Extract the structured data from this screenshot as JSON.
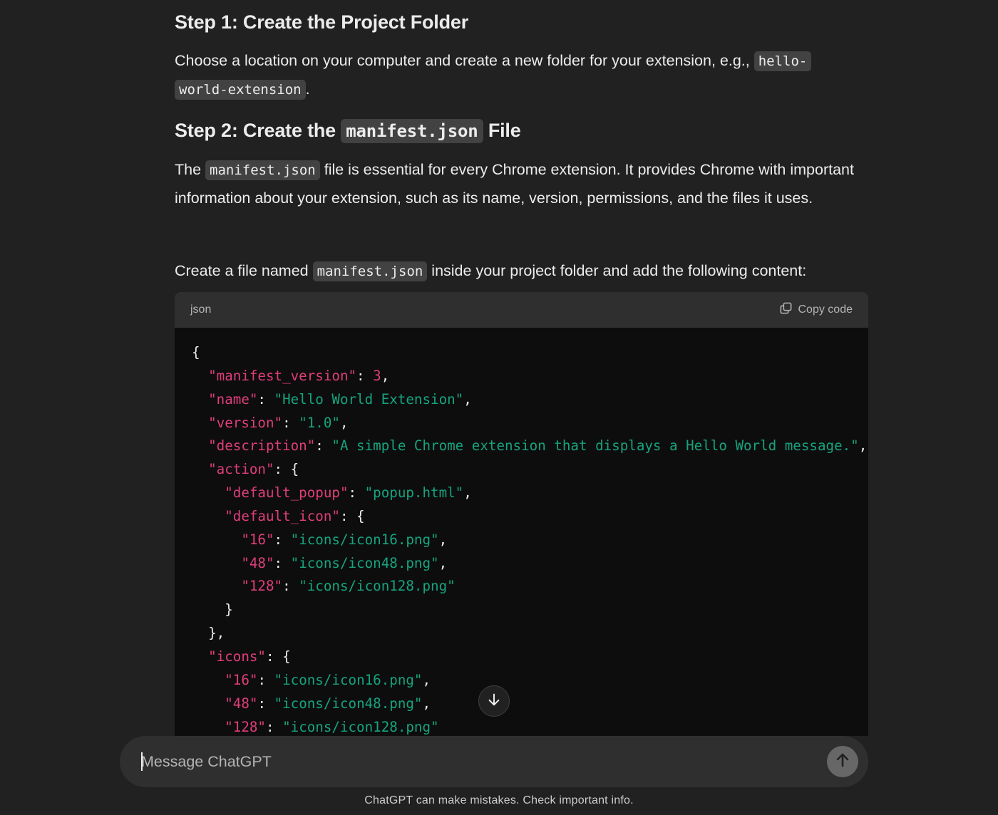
{
  "step1": {
    "heading": "Step 1: Create the Project Folder",
    "text_before": "Choose a location on your computer and create a new folder for your extension, e.g., ",
    "code_part1": "hello-",
    "code_part2": "world-extension",
    "text_after": "."
  },
  "step2": {
    "heading_before": "Step 2: Create the ",
    "heading_code": "manifest.json",
    "heading_after": " File",
    "p1_before": "The ",
    "p1_code": "manifest.json",
    "p1_after": " file is essential for every Chrome extension. It provides Chrome with important information about your extension, such as its name, version, permissions, and the files it uses.",
    "p2_before": "Create a file named ",
    "p2_code": "manifest.json",
    "p2_after": " inside your project folder and add the following content:"
  },
  "code_block": {
    "language": "json",
    "copy_label": "Copy code",
    "lines": [
      [
        {
          "t": "p",
          "v": "{"
        }
      ],
      [
        {
          "t": "p",
          "v": "  "
        },
        {
          "t": "k",
          "v": "\"manifest_version\""
        },
        {
          "t": "p",
          "v": ": "
        },
        {
          "t": "n",
          "v": "3"
        },
        {
          "t": "p",
          "v": ","
        }
      ],
      [
        {
          "t": "p",
          "v": "  "
        },
        {
          "t": "k",
          "v": "\"name\""
        },
        {
          "t": "p",
          "v": ": "
        },
        {
          "t": "s",
          "v": "\"Hello World Extension\""
        },
        {
          "t": "p",
          "v": ","
        }
      ],
      [
        {
          "t": "p",
          "v": "  "
        },
        {
          "t": "k",
          "v": "\"version\""
        },
        {
          "t": "p",
          "v": ": "
        },
        {
          "t": "s",
          "v": "\"1.0\""
        },
        {
          "t": "p",
          "v": ","
        }
      ],
      [
        {
          "t": "p",
          "v": "  "
        },
        {
          "t": "k",
          "v": "\"description\""
        },
        {
          "t": "p",
          "v": ": "
        },
        {
          "t": "s",
          "v": "\"A simple Chrome extension that displays a Hello World message.\""
        },
        {
          "t": "p",
          "v": ","
        }
      ],
      [
        {
          "t": "p",
          "v": "  "
        },
        {
          "t": "k",
          "v": "\"action\""
        },
        {
          "t": "p",
          "v": ": {"
        }
      ],
      [
        {
          "t": "p",
          "v": "    "
        },
        {
          "t": "k",
          "v": "\"default_popup\""
        },
        {
          "t": "p",
          "v": ": "
        },
        {
          "t": "s",
          "v": "\"popup.html\""
        },
        {
          "t": "p",
          "v": ","
        }
      ],
      [
        {
          "t": "p",
          "v": "    "
        },
        {
          "t": "k",
          "v": "\"default_icon\""
        },
        {
          "t": "p",
          "v": ": {"
        }
      ],
      [
        {
          "t": "p",
          "v": "      "
        },
        {
          "t": "k",
          "v": "\"16\""
        },
        {
          "t": "p",
          "v": ": "
        },
        {
          "t": "s",
          "v": "\"icons/icon16.png\""
        },
        {
          "t": "p",
          "v": ","
        }
      ],
      [
        {
          "t": "p",
          "v": "      "
        },
        {
          "t": "k",
          "v": "\"48\""
        },
        {
          "t": "p",
          "v": ": "
        },
        {
          "t": "s",
          "v": "\"icons/icon48.png\""
        },
        {
          "t": "p",
          "v": ","
        }
      ],
      [
        {
          "t": "p",
          "v": "      "
        },
        {
          "t": "k",
          "v": "\"128\""
        },
        {
          "t": "p",
          "v": ": "
        },
        {
          "t": "s",
          "v": "\"icons/icon128.png\""
        }
      ],
      [
        {
          "t": "p",
          "v": "    }"
        }
      ],
      [
        {
          "t": "p",
          "v": "  },"
        }
      ],
      [
        {
          "t": "p",
          "v": "  "
        },
        {
          "t": "k",
          "v": "\"icons\""
        },
        {
          "t": "p",
          "v": ": {"
        }
      ],
      [
        {
          "t": "p",
          "v": "    "
        },
        {
          "t": "k",
          "v": "\"16\""
        },
        {
          "t": "p",
          "v": ": "
        },
        {
          "t": "s",
          "v": "\"icons/icon16.png\""
        },
        {
          "t": "p",
          "v": ","
        }
      ],
      [
        {
          "t": "p",
          "v": "    "
        },
        {
          "t": "k",
          "v": "\"48\""
        },
        {
          "t": "p",
          "v": ": "
        },
        {
          "t": "s",
          "v": "\"icons/icon48.png\""
        },
        {
          "t": "p",
          "v": ","
        }
      ],
      [
        {
          "t": "p",
          "v": "    "
        },
        {
          "t": "k",
          "v": "\"128\""
        },
        {
          "t": "p",
          "v": ": "
        },
        {
          "t": "s",
          "v": "\"icons/icon128.png\""
        }
      ]
    ]
  },
  "composer": {
    "placeholder": "Message ChatGPT"
  },
  "footer": {
    "disclaimer": "ChatGPT can make mistakes. Check important info."
  },
  "colors": {
    "background": "#212121",
    "code_background": "#0d0d0d",
    "json_key": "#e03e7a",
    "json_string": "#16a47e",
    "json_number": "#e03e7a"
  },
  "icons": {
    "copy": "copy-icon",
    "scroll_down": "arrow-down-icon",
    "send": "arrow-up-icon"
  }
}
